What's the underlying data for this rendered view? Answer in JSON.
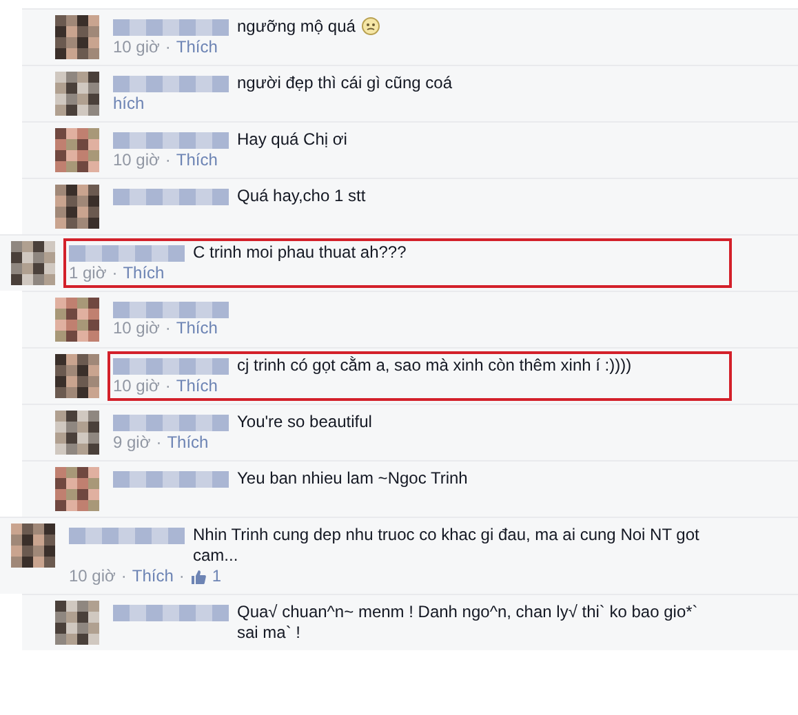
{
  "separator": "·",
  "comments": [
    {
      "reply": true,
      "highlighted": false,
      "text": "ngưỡng mộ quá",
      "emoji": true,
      "time": "10 giờ",
      "like": "Thích"
    },
    {
      "reply": true,
      "highlighted": false,
      "text": "người đẹp thì cái gì cũng coá",
      "like": "hích"
    },
    {
      "reply": true,
      "highlighted": false,
      "text": "Hay quá Chị ơi",
      "time": "10 giờ",
      "like": "Thích"
    },
    {
      "reply": true,
      "highlighted": false,
      "text": "Quá hay,cho 1 stt"
    },
    {
      "reply": false,
      "highlighted": true,
      "text": "C trinh moi phau thuat ah???",
      "time": "1 giờ",
      "like": "Thích"
    },
    {
      "reply": true,
      "highlighted": false,
      "time": "10 giờ",
      "like": "Thích"
    },
    {
      "reply": true,
      "highlighted": true,
      "text": "cj trinh có gọt cằm a, sao mà xinh còn thêm xinh í :))))",
      "time": "10 giờ",
      "like": "Thích"
    },
    {
      "reply": true,
      "highlighted": false,
      "text": "You're so beautiful",
      "time": "9 giờ",
      "like": "Thích"
    },
    {
      "reply": true,
      "highlighted": false,
      "text": "Yeu ban nhieu lam ~Ngoc Trinh"
    },
    {
      "reply": false,
      "highlighted": false,
      "text": "Nhin Trinh cung dep nhu truoc co khac gi đau, ma ai cung Noi NT got cam...",
      "time": "10 giờ",
      "like": "Thích",
      "likes": "1"
    },
    {
      "reply": true,
      "highlighted": false,
      "text": "Qua√ chuan^n~ menm ! Danh ngo^n, chan ly√ thi` ko bao gio*` sai ma` !"
    }
  ]
}
